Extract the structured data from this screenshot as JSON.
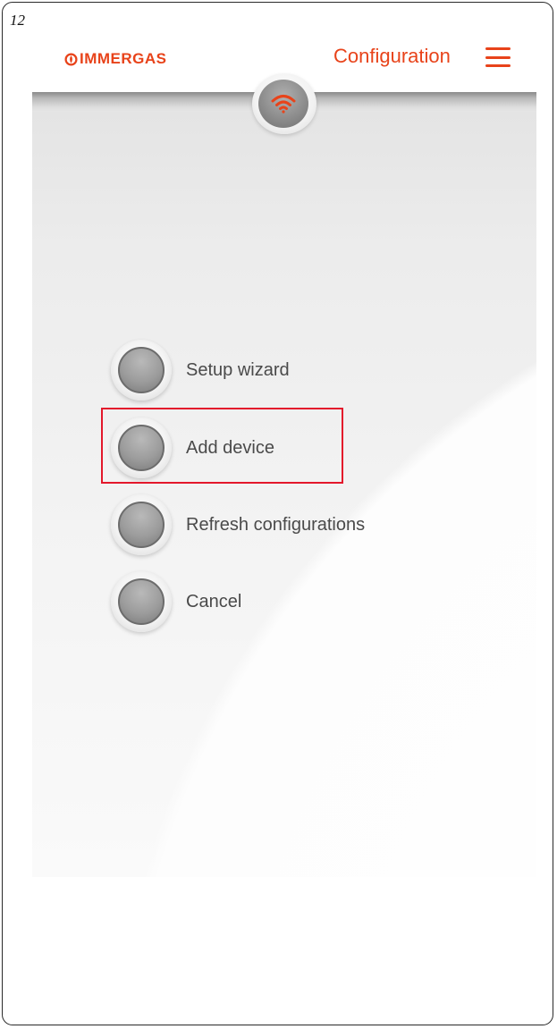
{
  "page_number": "12",
  "header": {
    "logo_text": "IMMERGAS",
    "title": "Configuration",
    "menu_icon": "hamburger-menu-icon"
  },
  "badge": {
    "icon": "wifi-icon"
  },
  "menu_options": [
    {
      "label": "Setup wizard"
    },
    {
      "label": "Add device"
    },
    {
      "label": "Refresh configurations"
    },
    {
      "label": "Cancel"
    }
  ],
  "highlighted_option": "Add device",
  "colors": {
    "brand": "#e8431a",
    "highlight_box": "#e3182b",
    "option_text": "#4a4a4a"
  }
}
